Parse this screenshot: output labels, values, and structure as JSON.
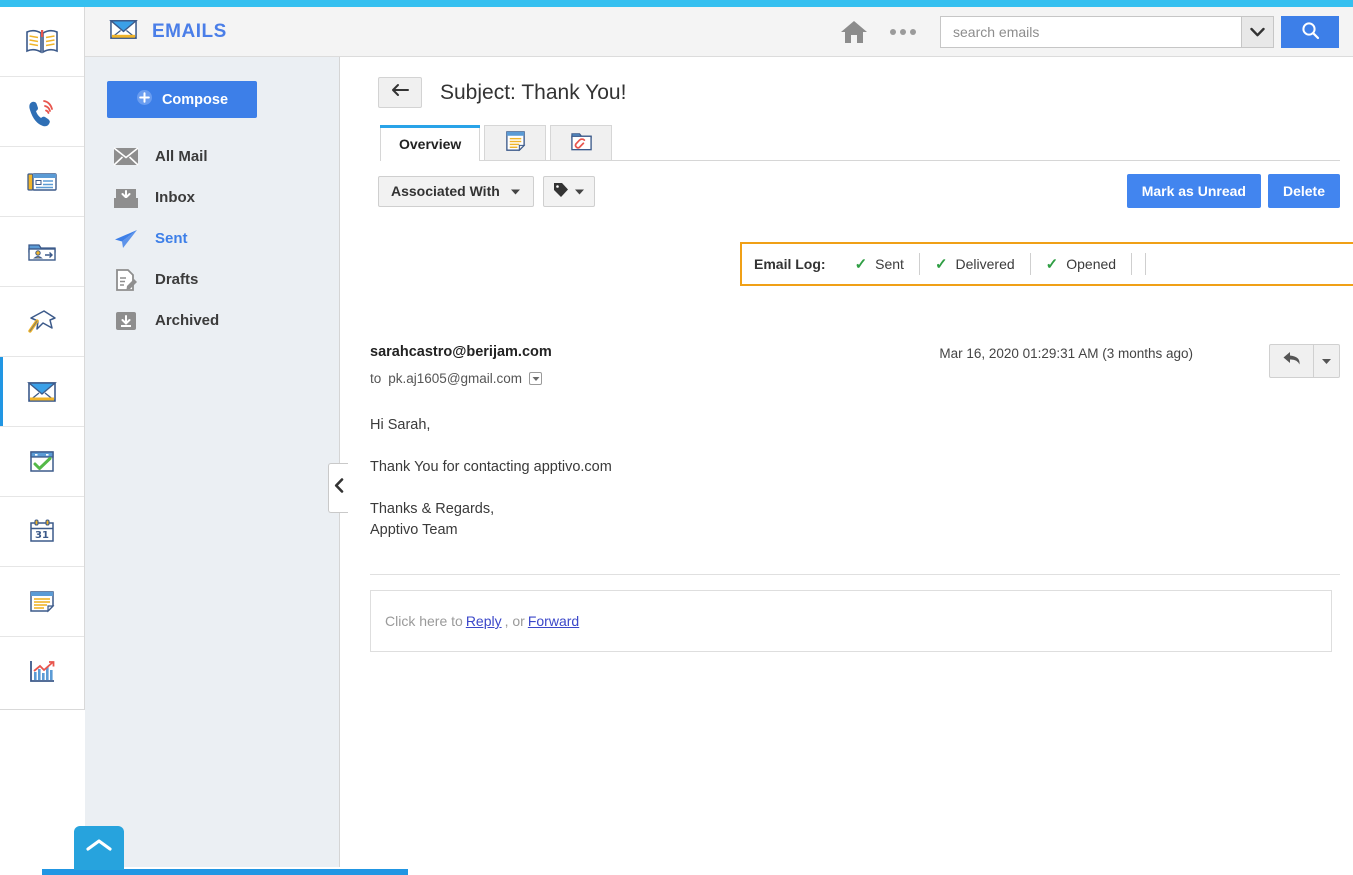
{
  "app_rail": {
    "items": [
      {
        "name": "book-icon",
        "label": "Knowledge Base"
      },
      {
        "name": "phone-ring-icon",
        "label": "Calls"
      },
      {
        "name": "news-card-icon",
        "label": "Cases"
      },
      {
        "name": "contact-folder-icon",
        "label": "Contacts"
      },
      {
        "name": "pushpin-icon",
        "label": "Leads"
      },
      {
        "name": "envelope-icon",
        "label": "Emails"
      },
      {
        "name": "checked-window-icon",
        "label": "Tasks"
      },
      {
        "name": "calendar-31-icon",
        "label": "Calendar"
      },
      {
        "name": "notes-icon",
        "label": "Notes"
      },
      {
        "name": "chart-icon",
        "label": "Reports"
      }
    ],
    "active_index": 5
  },
  "header": {
    "title": "EMAILS",
    "home_label": "Home",
    "more_label": "More",
    "search": {
      "placeholder": "search emails",
      "value": "",
      "caret_label": "Search options",
      "go_label": "Search"
    }
  },
  "nav_panel": {
    "compose_label": "Compose",
    "items": [
      {
        "label": "All Mail",
        "icon": "envelope-icon",
        "active": false
      },
      {
        "label": "Inbox",
        "icon": "inbox-icon",
        "active": false
      },
      {
        "label": "Sent",
        "icon": "paper-plane-icon",
        "active": true
      },
      {
        "label": "Drafts",
        "icon": "draft-pencil-icon",
        "active": false
      },
      {
        "label": "Archived",
        "icon": "archive-box-icon",
        "active": false
      }
    ],
    "collapse_label": "Collapse panel",
    "bottom_chevron_label": "Expand footer"
  },
  "content": {
    "back_label": "Back",
    "subject": "Subject: Thank You!",
    "tabs": [
      {
        "label": "Overview",
        "icon": null,
        "active": true
      },
      {
        "label": "",
        "icon": "notes-icon",
        "active": false
      },
      {
        "label": "",
        "icon": "attachment-folder-icon",
        "active": false
      }
    ],
    "toolbar": {
      "associated_with_label": "Associated With",
      "tag_label": "Tags",
      "mark_unread_label": "Mark as Unread",
      "delete_label": "Delete"
    },
    "email_log": {
      "title": "Email Log:",
      "statuses": [
        "Sent",
        "Delivered",
        "Opened"
      ],
      "highlight_color": "#f0a016",
      "check_color": "#2f9e44"
    },
    "message": {
      "from": "sarahcastro@berijam.com",
      "to_prefix": "to",
      "to": "pk.aj1605@gmail.com",
      "date": "Mar 16, 2020 01:29:31 AM (3 months ago)",
      "reply_label": "Reply",
      "reply_more_label": "More actions",
      "body": [
        "Hi Sarah,",
        "Thank You for contacting apptivo.com",
        "Thanks & Regards,\nApptivo Team"
      ]
    },
    "reply_prompt": {
      "prefix": "Click here to",
      "reply_link": "Reply",
      "separator": ", or",
      "forward_link": "Forward"
    }
  },
  "colors": {
    "accent_blue": "#3d7fe8",
    "strip_blue": "#35c0f0",
    "tab_active_blue": "#29a3e8",
    "panel_bg": "#ebeff3",
    "highlight_orange": "#f0a016"
  }
}
